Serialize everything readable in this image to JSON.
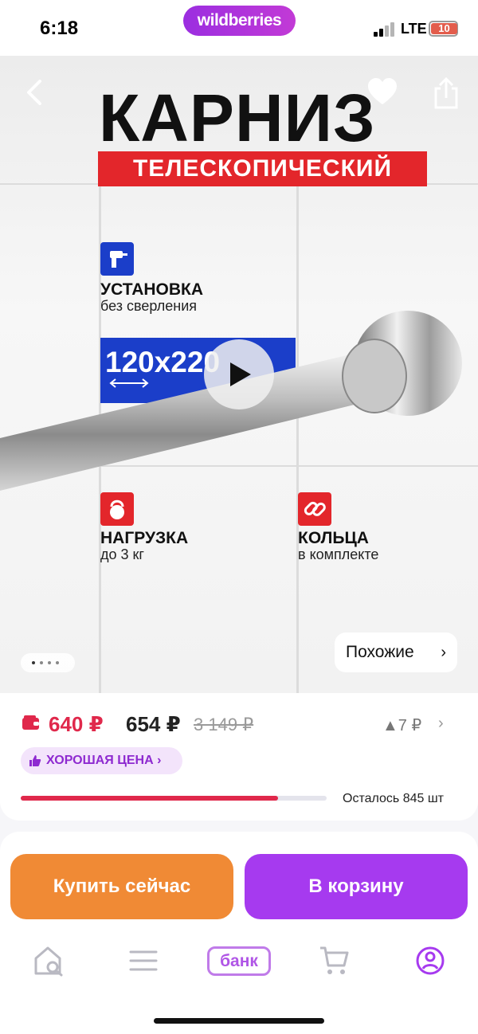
{
  "status_bar": {
    "time": "6:18",
    "network": "LTE",
    "battery": "10"
  },
  "brand": {
    "name": "wildberries"
  },
  "hero": {
    "title": "КАРНИЗ",
    "subtitle": "ТЕЛЕСКОПИЧЕСКИЙ",
    "features": [
      {
        "title": "УСТАНОВКА",
        "sub": "без сверления"
      },
      {
        "title": "НАГРУЗКА",
        "sub": "до 3 кг"
      },
      {
        "title": "КОЛЬЦА",
        "sub": "в комплекте"
      }
    ],
    "size": "120x220",
    "carousel_pages": 4,
    "carousel_active": 0,
    "similar_label": "Похожие",
    "similar_chevron": "›"
  },
  "price": {
    "wallet_price": "640 ₽",
    "price": "654 ₽",
    "old_price": "3 149 ₽",
    "delta": "▲7 ₽",
    "delta_chevron": "›",
    "badge": "ХОРОШАЯ ЦЕНА ›",
    "stock_text": "Осталось 845 шт",
    "stock_fraction": 0.84
  },
  "actions": {
    "buy_now": "Купить сейчас",
    "add_to_cart": "В корзину"
  },
  "nav": {
    "bank": "банк"
  },
  "colors": {
    "accent": "#a63aef",
    "buy": "#f08a35",
    "price_red": "#e0284b",
    "banner_red": "#e3262b",
    "banner_blue": "#1b3ec9"
  }
}
